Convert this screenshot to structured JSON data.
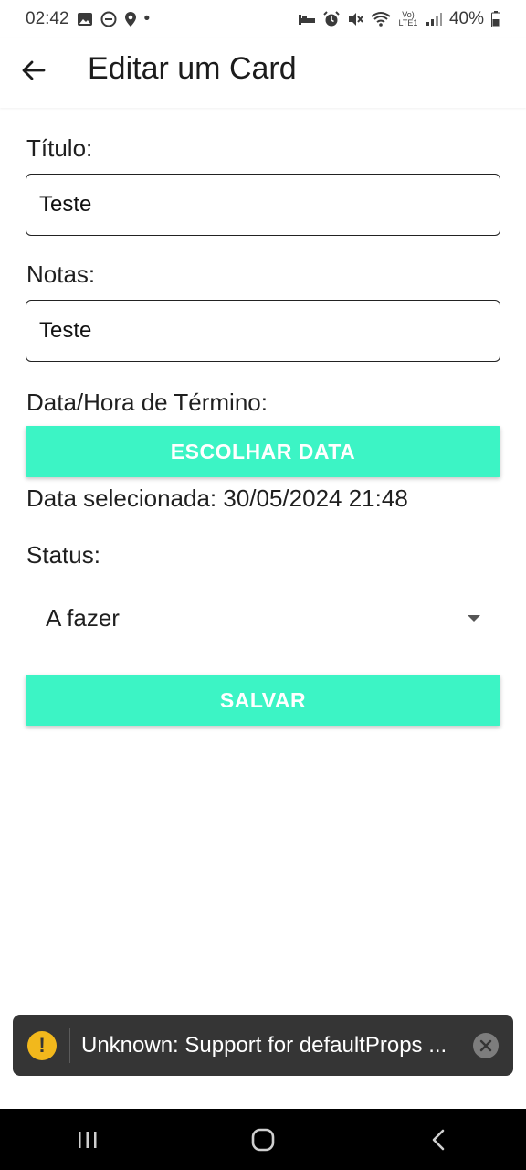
{
  "status_bar": {
    "time": "02:42",
    "dot": "•",
    "battery_percent": "40%",
    "network_label": "Vo) LTE1",
    "icons_left": [
      "image-icon",
      "dnd-icon",
      "location-icon"
    ],
    "icons_right": [
      "sleep-icon",
      "alarm-icon",
      "mute-icon",
      "wifi-icon",
      "signal-icon",
      "battery-icon"
    ]
  },
  "appbar": {
    "title": "Editar um Card"
  },
  "form": {
    "title_label": "Título:",
    "title_value": "Teste",
    "notes_label": "Notas:",
    "notes_value": "Teste",
    "deadline_label": "Data/Hora de Término:",
    "choose_date_button": "ESCOLHAR DATA",
    "selected_date_text": "Data selecionada: 30/05/2024 21:48",
    "status_label": "Status:",
    "status_value": "A fazer",
    "save_button": "SALVAR"
  },
  "toast": {
    "icon_glyph": "!",
    "message": "Unknown: Support for defaultProps ..."
  },
  "colors": {
    "accent": "#3cf4c5",
    "toast_bg": "#353535",
    "warning": "#f2b81c"
  }
}
